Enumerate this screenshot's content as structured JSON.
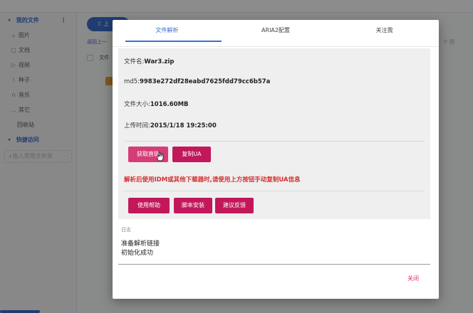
{
  "sidebar": {
    "my_files": "我的文件",
    "items": [
      {
        "label": "图片",
        "icon": "image-icon"
      },
      {
        "label": "文档",
        "icon": "document-icon"
      },
      {
        "label": "视频",
        "icon": "video-icon"
      },
      {
        "label": "种子",
        "icon": "torrent-icon"
      },
      {
        "label": "音乐",
        "icon": "music-icon"
      },
      {
        "label": "其它",
        "icon": "more-icon"
      }
    ],
    "recycle": "回收站",
    "quick_access": "快捷访问",
    "add_common_folder": "+拖入常用文件夹"
  },
  "main": {
    "upload": "上",
    "breadcrumb": "返回上一",
    "file_col": "文件",
    "count_hint": "个 图"
  },
  "dialog": {
    "tabs": [
      "文件解析",
      "ARIA2配置",
      "关注我"
    ],
    "active_tab": 0,
    "info": {
      "filename_label": "文件名:",
      "filename": "War3.zip",
      "md5_label": "md5:",
      "md5": "9983e272df28eabd7625fdd79cc6b57a",
      "size_label": "文件大小:",
      "size": "1016.60MB",
      "time_label": "上传时间:",
      "time": "2015/1/18 19:25:00"
    },
    "buttons": {
      "get_link": "获取直链",
      "copy_ua": "复制UA",
      "help": "使用帮助",
      "script_install": "脚本安装",
      "feedback": "建议反馈"
    },
    "hint": "解析后使用IDM或其他下载器时,请使用上方按钮手动复制UA信息",
    "log": {
      "label": "日志",
      "lines": [
        "准备解析链接",
        "初始化成功"
      ]
    },
    "close": "关闭"
  },
  "colors": {
    "accent": "#3b6fd0",
    "button": "#c2185b",
    "hint": "#d32f2f"
  }
}
